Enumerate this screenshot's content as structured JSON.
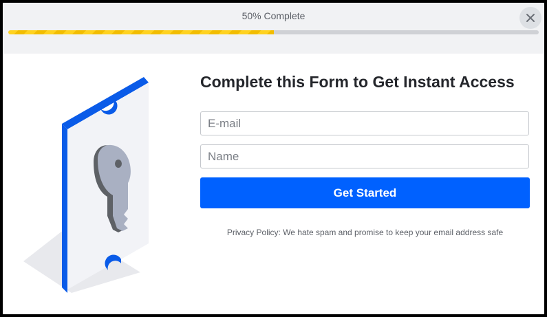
{
  "progress": {
    "label": "50% Complete",
    "percent": 50,
    "colors": {
      "fill": "#ffd21f",
      "track": "#cfd1d5"
    }
  },
  "close": {
    "icon": "close-icon"
  },
  "illustration": {
    "icon": "key-ticket-icon",
    "accent": "#0a5be8"
  },
  "form": {
    "title": "Complete this Form to Get Instant Access",
    "email_placeholder": "E-mail",
    "name_placeholder": "Name",
    "email_value": "",
    "name_value": "",
    "submit_label": "Get Started",
    "submit_color": "#0061ff",
    "privacy": "Privacy Policy: We hate spam and promise to keep your email address safe"
  }
}
